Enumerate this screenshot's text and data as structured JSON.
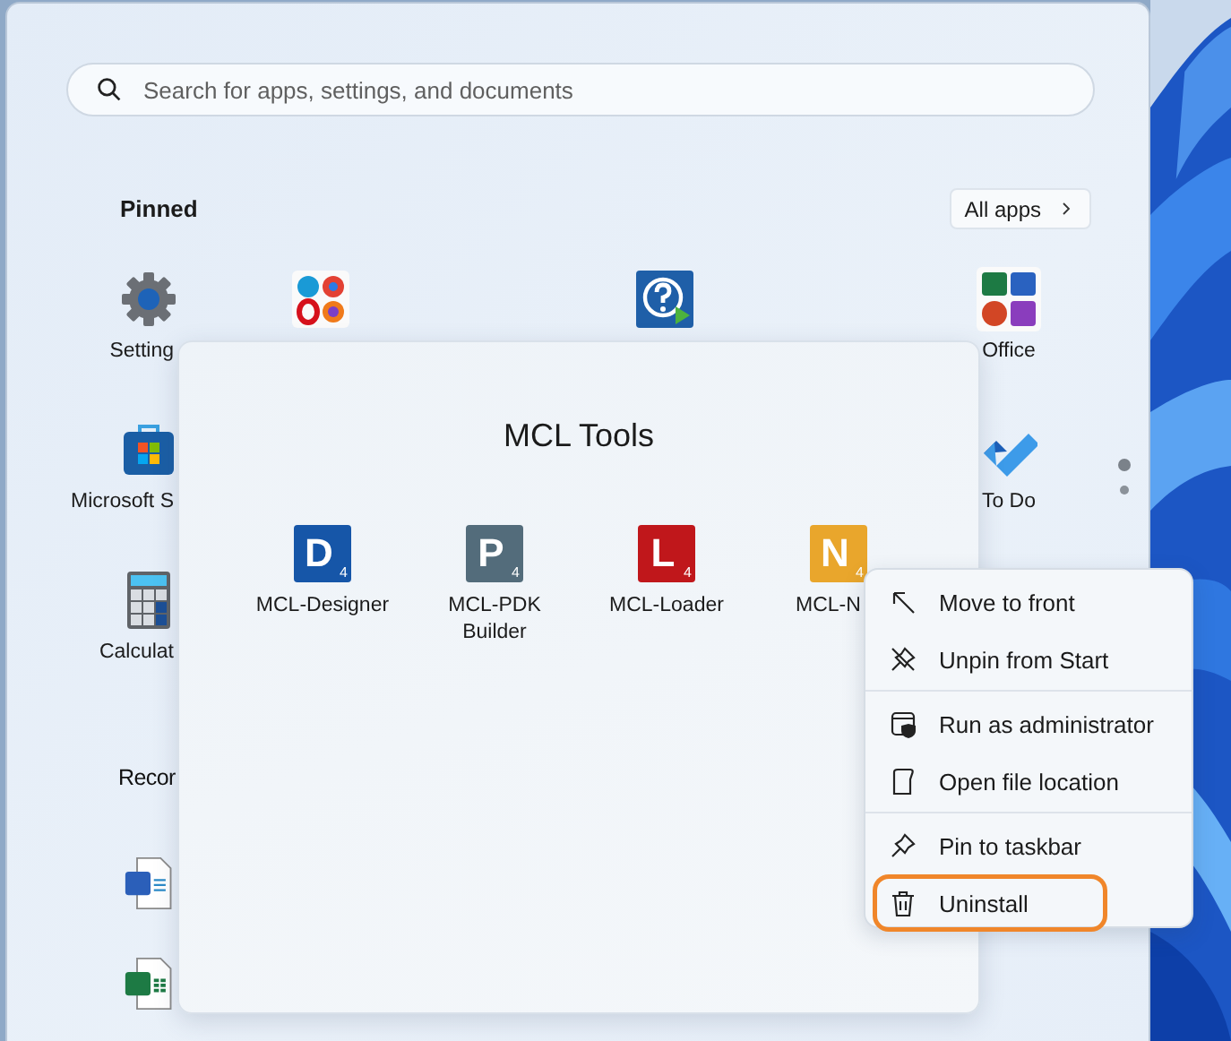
{
  "search": {
    "placeholder": "Search for apps, settings, and documents"
  },
  "pinned": {
    "title": "Pinned",
    "all_apps": {
      "label": "All apps"
    },
    "rows": [
      {
        "items": [
          {
            "kind": "settings",
            "label": "Setting"
          },
          {
            "kind": "browsers"
          },
          {
            "kind": "empty"
          },
          {
            "kind": "help"
          },
          {
            "kind": "empty"
          },
          {
            "kind": "office",
            "label": "Office"
          }
        ]
      },
      {
        "items": [
          {
            "kind": "store",
            "label": "Microsoft S"
          },
          {
            "kind": "empty"
          },
          {
            "kind": "empty"
          },
          {
            "kind": "empty"
          },
          {
            "kind": "empty"
          },
          {
            "kind": "todo",
            "label": "To Do"
          }
        ]
      },
      {
        "items": [
          {
            "kind": "calculator",
            "label": "Calculat"
          }
        ]
      }
    ],
    "pages": [
      {
        "selected": true
      },
      {
        "selected": false
      }
    ]
  },
  "recommended": {
    "title": "Recor",
    "files": [
      {
        "kind": "word"
      },
      {
        "kind": "excel"
      }
    ]
  },
  "folder": {
    "title": "MCL Tools",
    "apps": [
      {
        "letter": "D",
        "sub": "4",
        "color": "#1656a8",
        "label": "MCL-Designer"
      },
      {
        "letter": "P",
        "sub": "4",
        "color": "#536c7b",
        "label": "MCL-PDK Builder"
      },
      {
        "letter": "L",
        "sub": "4",
        "color": "#c0171b",
        "label": "MCL-Loader"
      },
      {
        "letter": "N",
        "sub": "4",
        "color": "#e9a62c",
        "label": "MCL-N"
      }
    ]
  },
  "context_menu": {
    "groups": [
      [
        {
          "kind": "move",
          "label": "Move to front",
          "highlighted": false
        },
        {
          "kind": "unpin",
          "label": "Unpin from Start",
          "highlighted": false
        }
      ],
      [
        {
          "kind": "admin",
          "label": "Run as administrator",
          "highlighted": false
        },
        {
          "kind": "location",
          "label": "Open file location",
          "highlighted": false
        }
      ],
      [
        {
          "kind": "pin",
          "label": "Pin to taskbar",
          "highlighted": false
        },
        {
          "kind": "trash",
          "label": "Uninstall",
          "highlighted": true
        }
      ]
    ]
  }
}
